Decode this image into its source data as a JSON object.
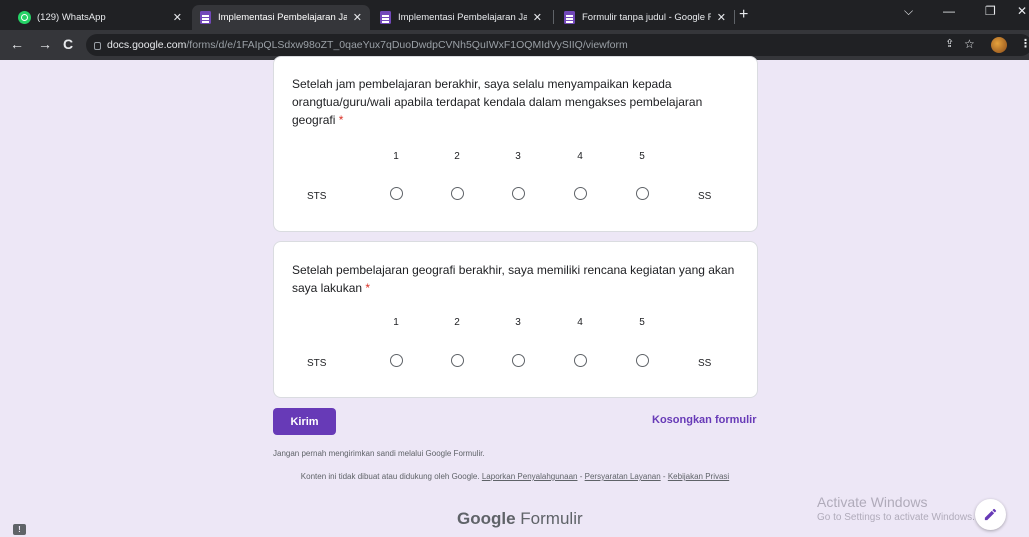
{
  "browser": {
    "tabs": [
      {
        "title": "(129) WhatsApp",
        "icon": "whatsapp-icon"
      },
      {
        "title": "Implementasi Pembelajaran Jarak",
        "icon": "google-forms-icon",
        "active": true
      },
      {
        "title": "Implementasi Pembelajaran Jarak",
        "icon": "google-forms-icon"
      },
      {
        "title": "Formulir tanpa judul - Google Fo",
        "icon": "google-forms-icon"
      }
    ],
    "new_tab": "+",
    "window_controls": {
      "dropdown": "⌵",
      "minimize": "—",
      "restore": "❐",
      "close": "✕"
    },
    "url_host": "docs.google.com",
    "url_path": "/forms/d/e/1FAIpQLSdxw98oZT_0qaeYux7qDuoDwdpCVNh5QuIWxF1OQMIdVySIIQ/viewform"
  },
  "form": {
    "questions": [
      {
        "text": "Setelah jam pembelajaran berakhir, saya selalu menyampaikan kepada orangtua/guru/wali apabila terdapat kendala dalam mengakses pembelajaran geografi",
        "required_mark": "*",
        "scale": [
          "1",
          "2",
          "3",
          "4",
          "5"
        ],
        "low_label": "STS",
        "high_label": "SS"
      },
      {
        "text": "Setelah pembelajaran geografi berakhir, saya memiliki rencana kegiatan yang akan saya lakukan",
        "required_mark": "*",
        "scale": [
          "1",
          "2",
          "3",
          "4",
          "5"
        ],
        "low_label": "STS",
        "high_label": "SS"
      }
    ],
    "submit_label": "Kirim",
    "clear_label": "Kosongkan formulir",
    "password_note": "Jangan pernah mengirimkan sandi melalui Google Formulir.",
    "disclaimer_prefix": "Konten ini tidak dibuat atau didukung oleh Google.",
    "link_abuse": "Laporkan Penyalahgunaan",
    "link_terms": "Persyaratan Layanan",
    "link_privacy": "Kebijakan Privasi",
    "link_separator": "-",
    "brand_google": "Google",
    "brand_product": "Formulir",
    "report_icon": "!"
  },
  "os_overlay": {
    "activate_title": "Activate Windows",
    "activate_sub": "Go to Settings to activate Windows."
  },
  "colors": {
    "page_background": "#ede7f6",
    "accent": "#673ab7",
    "required": "#d93025"
  }
}
